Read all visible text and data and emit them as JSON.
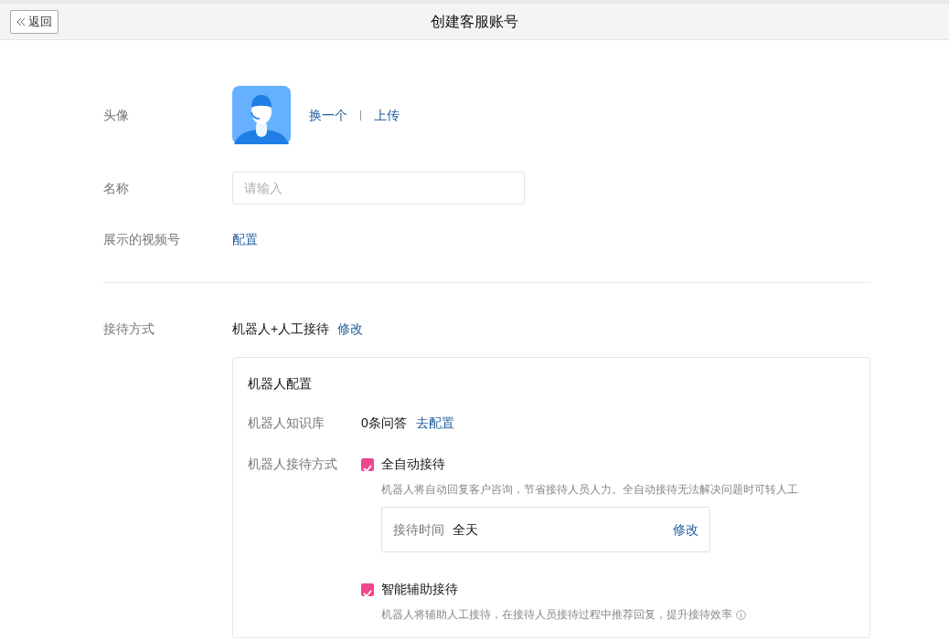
{
  "header": {
    "back_label": "返回",
    "title": "创建客服账号"
  },
  "avatar": {
    "label": "头像",
    "actions": [
      "换一个",
      "上传"
    ]
  },
  "name": {
    "label": "名称",
    "placeholder": "请输入"
  },
  "video": {
    "label": "展示的视频号",
    "link": "配置"
  },
  "reception": {
    "label": "接待方式",
    "value": "机器人+人工接待",
    "link": "修改"
  },
  "robot_config": {
    "title": "机器人配置",
    "knowledge": {
      "label": "机器人知识库",
      "value": "0条问答",
      "link": "去配置"
    },
    "modes_label": "机器人接待方式",
    "modes": [
      {
        "label": "全自动接待",
        "checked": true,
        "description": "机器人将自动回复客户咨询，节省接待人员人力。全自动接待无法解决问题时可转人工",
        "info": false,
        "schedule": {
          "label": "接待时间",
          "value": "全天",
          "link": "修改"
        }
      },
      {
        "label": "智能辅助接待",
        "checked": true,
        "description": "机器人将辅助人工接待，在接待人员接待过程中推荐回复，提升接待效率",
        "info": true
      }
    ]
  }
}
